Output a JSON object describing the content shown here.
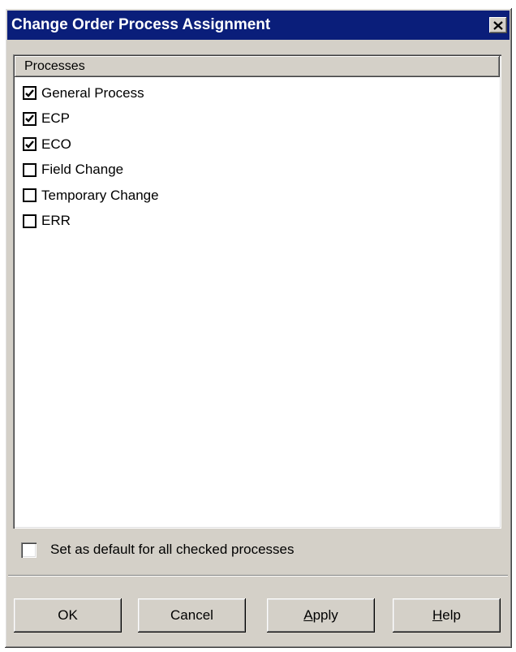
{
  "window": {
    "title": "Change Order Process Assignment"
  },
  "icons": {
    "close": "close-icon",
    "check": "checkmark-icon"
  },
  "colors": {
    "titlebar": "#0a1e7a",
    "dialog_face": "#d4d0c8",
    "list_background": "#ffffff"
  },
  "list": {
    "header": "Processes",
    "items": [
      {
        "label": "General Process",
        "checked": true
      },
      {
        "label": "ECP",
        "checked": true
      },
      {
        "label": "ECO",
        "checked": true
      },
      {
        "label": "Field Change",
        "checked": false
      },
      {
        "label": "Temporary Change",
        "checked": false
      },
      {
        "label": "ERR",
        "checked": false
      }
    ]
  },
  "default_option": {
    "label": "Set as default for all checked processes",
    "checked": false
  },
  "buttons": {
    "ok": "OK",
    "cancel": "Cancel",
    "apply_mnemonic": "A",
    "apply_rest": "pply",
    "help_mnemonic": "H",
    "help_rest": "elp"
  }
}
